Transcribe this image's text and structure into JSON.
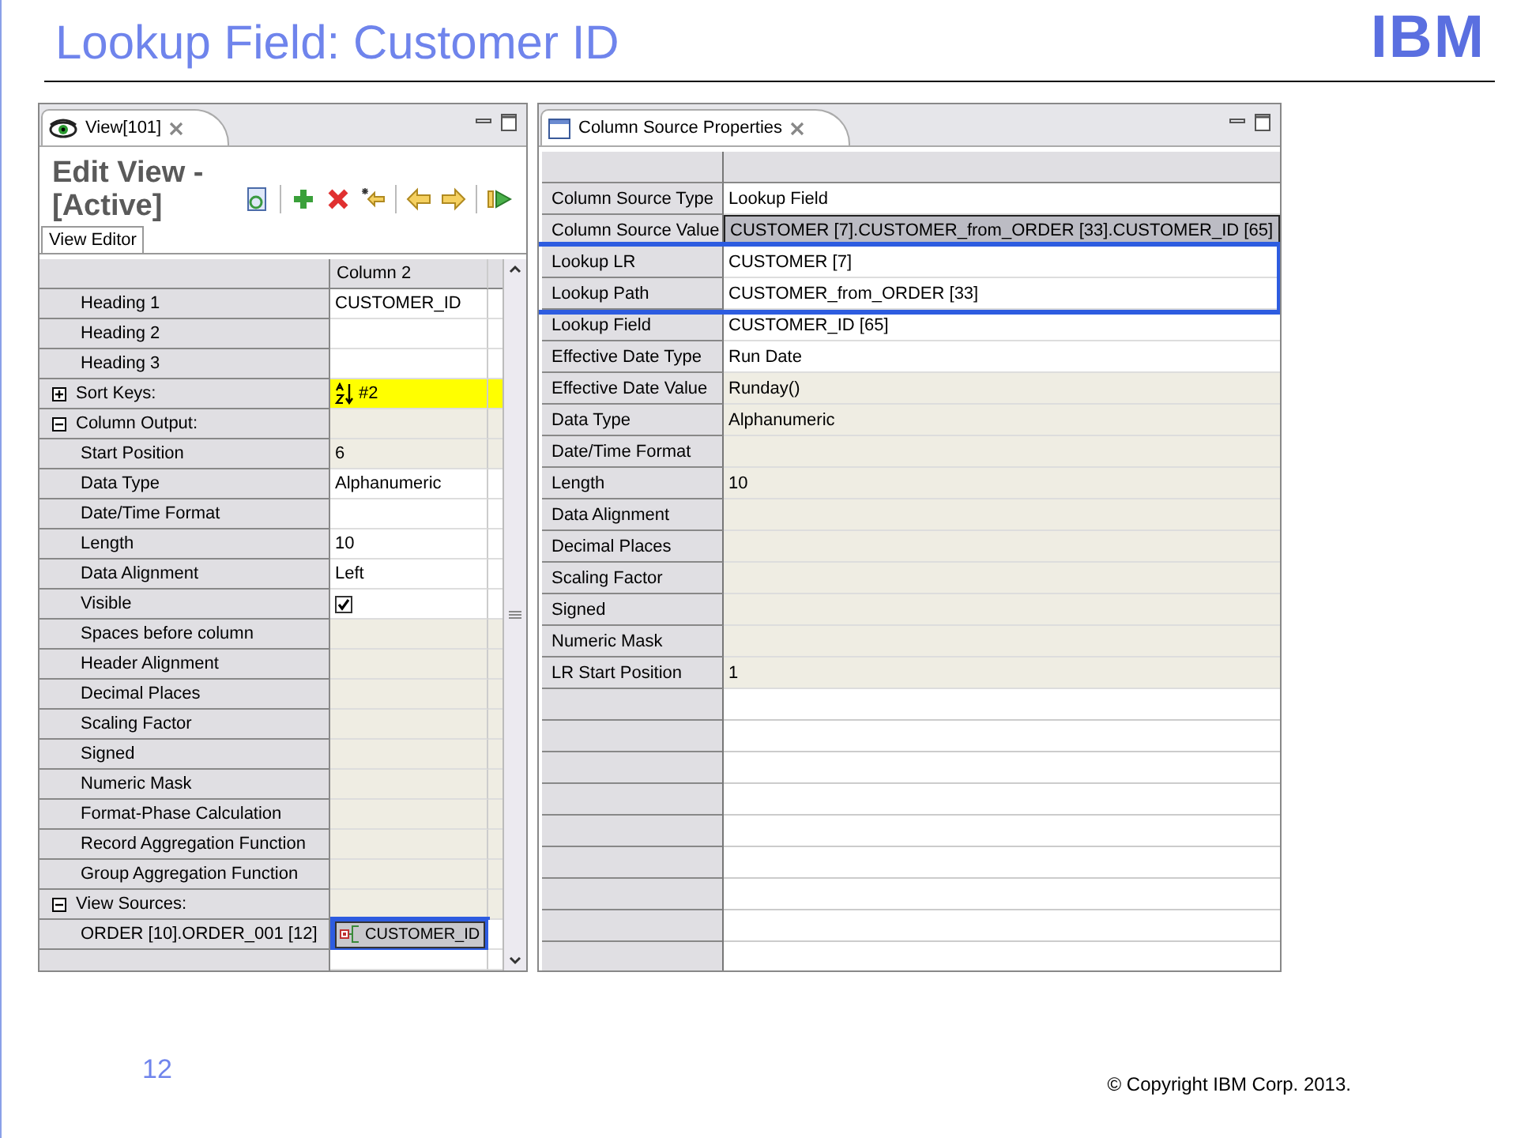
{
  "slide": {
    "title": "Lookup Field: Customer ID",
    "logo": "IBM",
    "page_number": "12",
    "copyright": "© Copyright  IBM Corp. 2013."
  },
  "left_panel": {
    "tab": {
      "title": "View[101]"
    },
    "heading": "Edit View - [Active]",
    "sub_tabs": [
      {
        "label": "View Editor",
        "selected": true
      }
    ],
    "table": {
      "columns": [
        "Column 2"
      ],
      "rows": [
        {
          "kind": "text",
          "label": "Heading 1",
          "value": "CUSTOMER_ID",
          "read_only": false
        },
        {
          "kind": "text",
          "label": "Heading 2",
          "read_only": false
        },
        {
          "kind": "text",
          "label": "Heading 3",
          "read_only": false
        },
        {
          "kind": "sort",
          "label": "Sort Keys:",
          "value": "#2",
          "expanded": false
        },
        {
          "kind": "group",
          "label": "Column Output:",
          "expanded": true
        },
        {
          "kind": "text",
          "label": "Start Position",
          "value": "6",
          "read_only": true
        },
        {
          "kind": "text",
          "label": "Data Type",
          "value": "Alphanumeric",
          "read_only": false
        },
        {
          "kind": "text",
          "label": "Date/Time Format",
          "read_only": false
        },
        {
          "kind": "text",
          "label": "Length",
          "value": "10",
          "read_only": false
        },
        {
          "kind": "text",
          "label": "Data Alignment",
          "value": "Left",
          "read_only": false
        },
        {
          "kind": "checkbox",
          "label": "Visible",
          "checked": true
        },
        {
          "kind": "text",
          "label": "Spaces before column",
          "read_only": true
        },
        {
          "kind": "text",
          "label": "Header Alignment",
          "read_only": true
        },
        {
          "kind": "text",
          "label": "Decimal Places",
          "read_only": true
        },
        {
          "kind": "text",
          "label": "Scaling Factor",
          "read_only": true
        },
        {
          "kind": "text",
          "label": "Signed",
          "read_only": true
        },
        {
          "kind": "text",
          "label": "Numeric Mask",
          "read_only": true
        },
        {
          "kind": "text",
          "label": "Format-Phase Calculation",
          "read_only": true
        },
        {
          "kind": "text",
          "label": "Record Aggregation Function",
          "read_only": true
        },
        {
          "kind": "text",
          "label": "Group Aggregation Function",
          "read_only": true
        },
        {
          "kind": "group",
          "label": "View Sources:",
          "expanded": true
        },
        {
          "kind": "source",
          "label": "ORDER [10].ORDER_001 [12]",
          "value": "CUSTOMER_ID",
          "selected": true
        }
      ]
    }
  },
  "right_panel": {
    "tab": {
      "title": "Column Source Properties"
    },
    "rows": [
      {
        "label": "Column Source Type",
        "value": "Lookup Field",
        "read_only": false,
        "selected": false,
        "highlighted": false
      },
      {
        "label": "Column Source Value",
        "value": "CUSTOMER [7].CUSTOMER_from_ORDER [33].CUSTOMER_ID [65]",
        "read_only": false,
        "selected": true,
        "highlighted": false
      },
      {
        "label": "Lookup LR",
        "value": "CUSTOMER [7]",
        "read_only": false,
        "selected": false,
        "highlighted": true
      },
      {
        "label": "Lookup Path",
        "value": "CUSTOMER_from_ORDER [33]",
        "read_only": false,
        "selected": false,
        "highlighted": true
      },
      {
        "label": "Lookup Field",
        "value": "CUSTOMER_ID [65]",
        "read_only": false,
        "selected": false,
        "highlighted": false
      },
      {
        "label": "Effective Date Type",
        "value": "Run Date",
        "read_only": false,
        "selected": false,
        "highlighted": false
      },
      {
        "label": "Effective Date Value",
        "value": "Runday()",
        "read_only": true,
        "selected": false,
        "highlighted": false
      },
      {
        "label": "Data Type",
        "value": "Alphanumeric",
        "read_only": true,
        "selected": false,
        "highlighted": false
      },
      {
        "label": "Date/Time Format",
        "read_only": true,
        "selected": false,
        "highlighted": false
      },
      {
        "label": "Length",
        "value": "10",
        "read_only": true,
        "selected": false,
        "highlighted": false
      },
      {
        "label": "Data Alignment",
        "read_only": true,
        "selected": false,
        "highlighted": false
      },
      {
        "label": "Decimal Places",
        "read_only": true,
        "selected": false,
        "highlighted": false
      },
      {
        "label": "Scaling Factor",
        "read_only": true,
        "selected": false,
        "highlighted": false
      },
      {
        "label": "Signed",
        "read_only": true,
        "selected": false,
        "highlighted": false
      },
      {
        "label": "Numeric Mask",
        "read_only": true,
        "selected": false,
        "highlighted": false
      },
      {
        "label": "LR Start Position",
        "value": "1",
        "read_only": true,
        "selected": false,
        "highlighted": false
      }
    ]
  }
}
